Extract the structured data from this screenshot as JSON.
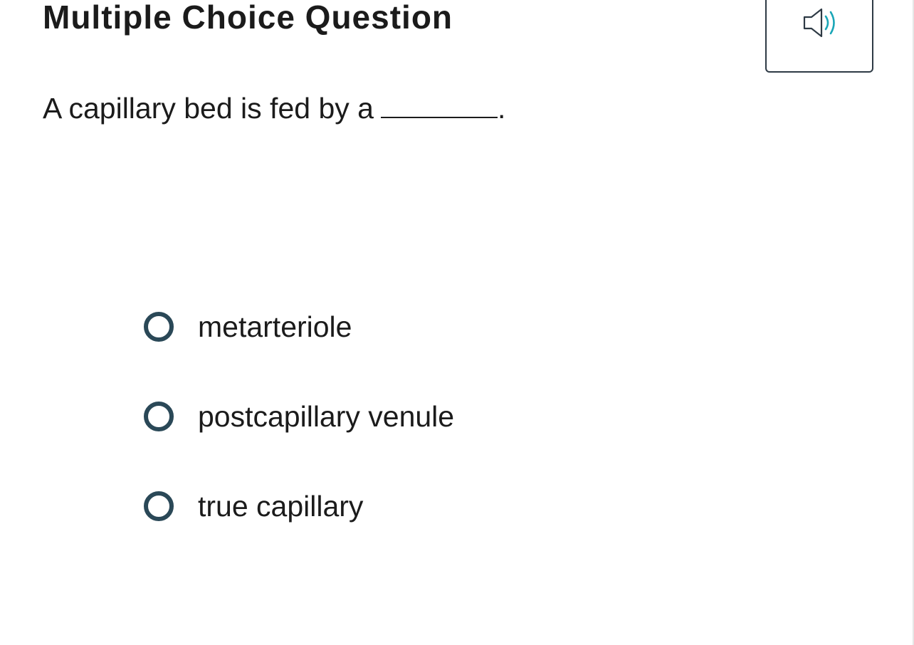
{
  "header": {
    "title": "Multiple Choice Question"
  },
  "audio": {
    "icon": "speaker-icon",
    "accent_color": "#1aa6b7"
  },
  "question": {
    "prefix": "A capillary bed is fed by a",
    "suffix": "."
  },
  "options": [
    {
      "label": "metarteriole",
      "selected": false
    },
    {
      "label": "postcapillary venule",
      "selected": false
    },
    {
      "label": "true capillary",
      "selected": false
    }
  ],
  "colors": {
    "text": "#1b1b1b",
    "radio_border": "#2a4857",
    "button_border": "#2e3a45"
  }
}
